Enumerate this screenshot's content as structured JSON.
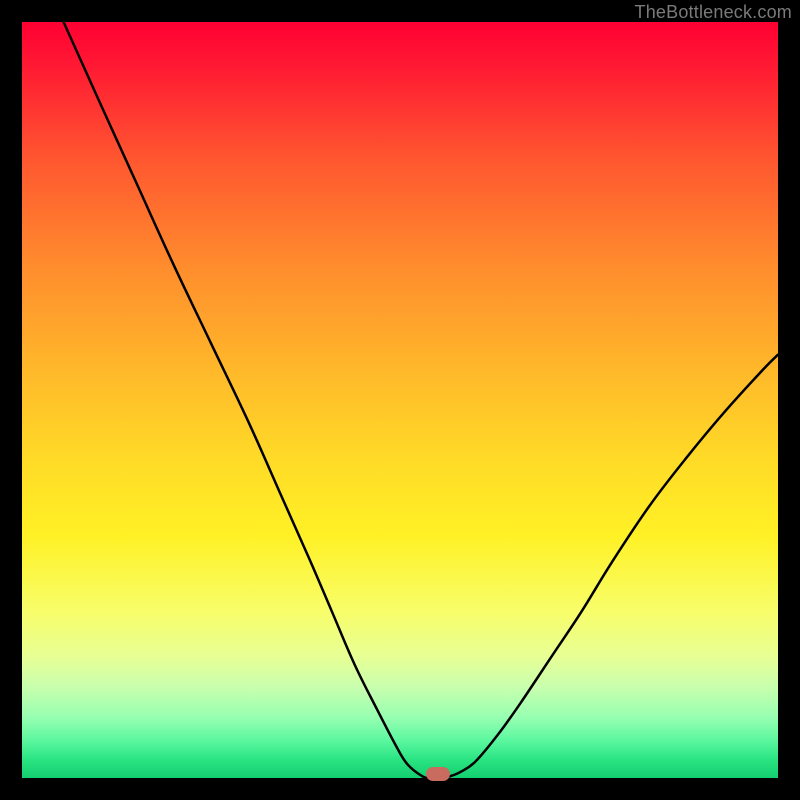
{
  "watermark": "TheBottleneck.com",
  "chart_data": {
    "type": "line",
    "title": "",
    "xlabel": "",
    "ylabel": "",
    "x_range": [
      0,
      100
    ],
    "y_range": [
      0,
      100
    ],
    "series": [
      {
        "name": "bottleneck-curve",
        "x": [
          5.5,
          10,
          15,
          20,
          25,
          30,
          34,
          38,
          41,
          44,
          47,
          49.5,
          51,
          53,
          54,
          55,
          56.5,
          58,
          60,
          63,
          66,
          70,
          74,
          78,
          83,
          88,
          93,
          98,
          100
        ],
        "y": [
          100,
          90,
          79,
          68,
          57.5,
          47,
          38,
          29,
          22,
          15,
          9,
          4.2,
          1.8,
          0.2,
          0,
          0,
          0.2,
          0.8,
          2.2,
          5.8,
          10,
          16,
          22,
          28.5,
          36,
          42.5,
          48.5,
          54,
          56
        ]
      }
    ],
    "flat_segment": {
      "x_start": 53,
      "x_end": 56.5,
      "y": 0
    },
    "marker": {
      "x": 55,
      "y": 0.5,
      "color": "#c96b5f"
    },
    "background_gradient": {
      "top": "#ff0033",
      "mid": "#ffdb27",
      "bottom": "#14cf6f"
    }
  }
}
